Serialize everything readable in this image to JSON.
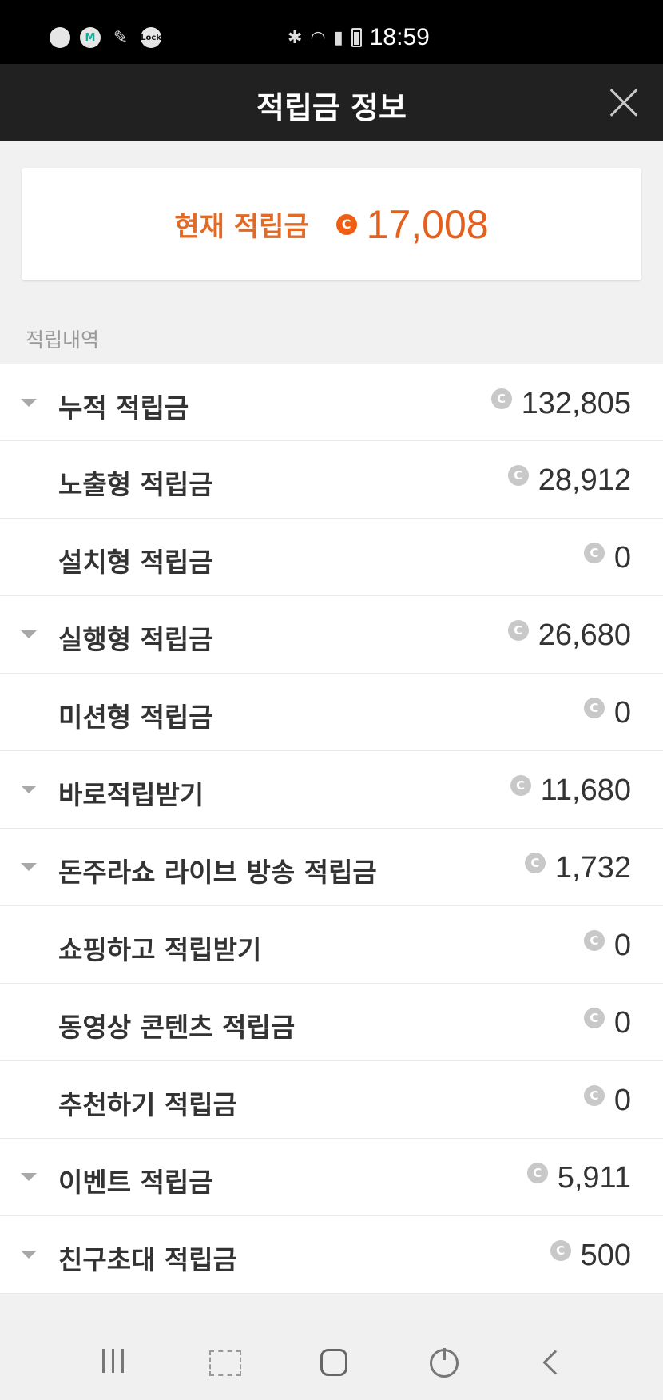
{
  "status_bar": {
    "time": "18:59",
    "left_icons": [
      "talk-icon",
      "m-app-icon",
      "feather-icon",
      "lock-app-icon"
    ],
    "lock_label": "Lock",
    "m_label": "M",
    "right_icons": [
      "bluetooth-icon",
      "wifi-icon",
      "signal-icon",
      "battery-icon"
    ]
  },
  "header": {
    "title": "적립금 정보",
    "close_icon": "close-icon"
  },
  "summary": {
    "label": "현재 적립금",
    "coin_symbol": "C",
    "value": "17,008",
    "accent_color": "#e4601e"
  },
  "section": {
    "label": "적립내역"
  },
  "rows": [
    {
      "label": "누적 적립금",
      "value": "132,805",
      "expandable": true
    },
    {
      "label": "노출형 적립금",
      "value": "28,912",
      "expandable": false
    },
    {
      "label": "설치형 적립금",
      "value": "0",
      "expandable": false
    },
    {
      "label": "실행형 적립금",
      "value": "26,680",
      "expandable": true
    },
    {
      "label": "미션형 적립금",
      "value": "0",
      "expandable": false
    },
    {
      "label": "바로적립받기",
      "value": "11,680",
      "expandable": true
    },
    {
      "label": "돈주라쇼 라이브 방송 적립금",
      "value": "1,732",
      "expandable": true
    },
    {
      "label": "쇼핑하고 적립받기",
      "value": "0",
      "expandable": false
    },
    {
      "label": "동영상 콘텐츠 적립금",
      "value": "0",
      "expandable": false
    },
    {
      "label": "추천하기 적립금",
      "value": "0",
      "expandable": false
    },
    {
      "label": "이벤트 적립금",
      "value": "5,911",
      "expandable": true
    },
    {
      "label": "친구초대 적립금",
      "value": "500",
      "expandable": true
    }
  ],
  "coin_symbol": "C",
  "nav_bar": {
    "icons": [
      "recent-apps-icon",
      "scan-icon",
      "home-icon",
      "power-icon",
      "back-icon"
    ]
  }
}
